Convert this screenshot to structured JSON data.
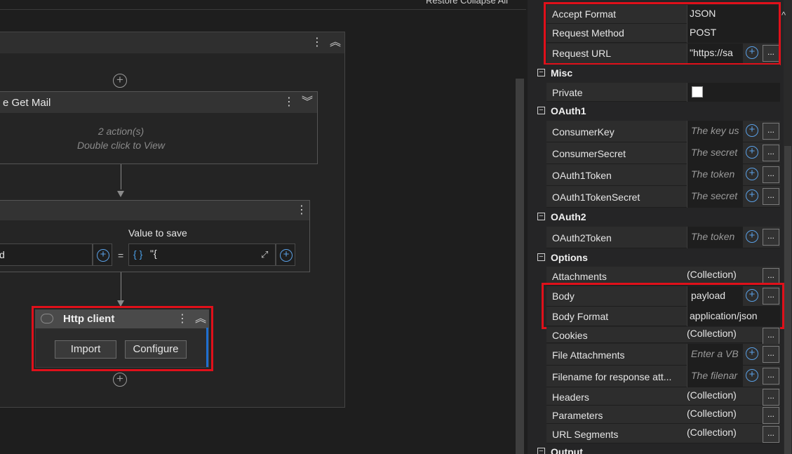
{
  "designer": {
    "top_links": "Restore    Collapse All",
    "mail_activity": {
      "title": "e Get Mail",
      "line1": "2 action(s)",
      "line2": "Double click to View"
    },
    "assign": {
      "value_label": "Value to save",
      "to_value": "d",
      "equals": "=",
      "brace_icon": "{ }",
      "value_text": "\"{"
    },
    "http_client": {
      "title": "Http client",
      "import_label": "Import",
      "configure_label": "Configure"
    }
  },
  "properties": {
    "rows_top": [
      {
        "name": "Accept Format",
        "value": "JSON"
      },
      {
        "name": "Request Method",
        "value": "POST"
      },
      {
        "name": "Request URL",
        "value": "\"https://sa"
      }
    ],
    "categories": {
      "misc": "Misc",
      "oauth1": "OAuth1",
      "oauth2": "OAuth2",
      "options": "Options",
      "output": "Output"
    },
    "misc_rows": [
      {
        "name": "Private"
      }
    ],
    "oauth1_rows": [
      {
        "name": "ConsumerKey",
        "placeholder": "The key us"
      },
      {
        "name": "ConsumerSecret",
        "placeholder": "The secret"
      },
      {
        "name": "OAuth1Token",
        "placeholder": "The token"
      },
      {
        "name": "OAuth1TokenSecret",
        "placeholder": "The secret"
      }
    ],
    "oauth2_rows": [
      {
        "name": "OAuth2Token",
        "placeholder": "The token"
      }
    ],
    "options_rows": [
      {
        "name": "Attachments",
        "value": "(Collection)"
      },
      {
        "name": "Body",
        "value": "payload"
      },
      {
        "name": "Body Format",
        "value": "application/json"
      },
      {
        "name": "Cookies",
        "value": "(Collection)"
      },
      {
        "name": "File Attachments",
        "placeholder": "Enter a VB"
      },
      {
        "name": "Filename for response att...",
        "placeholder": "The filenar"
      },
      {
        "name": "Headers",
        "value": "(Collection)"
      },
      {
        "name": "Parameters",
        "value": "(Collection)"
      },
      {
        "name": "URL Segments",
        "value": "(Collection)"
      }
    ],
    "ellipsis": "...",
    "plus": "+",
    "toggle_minus": "−"
  },
  "colors": {
    "highlight_red": "#e0101a",
    "accent_blue": "#5aa0e6",
    "background": "#1e1e1e"
  }
}
